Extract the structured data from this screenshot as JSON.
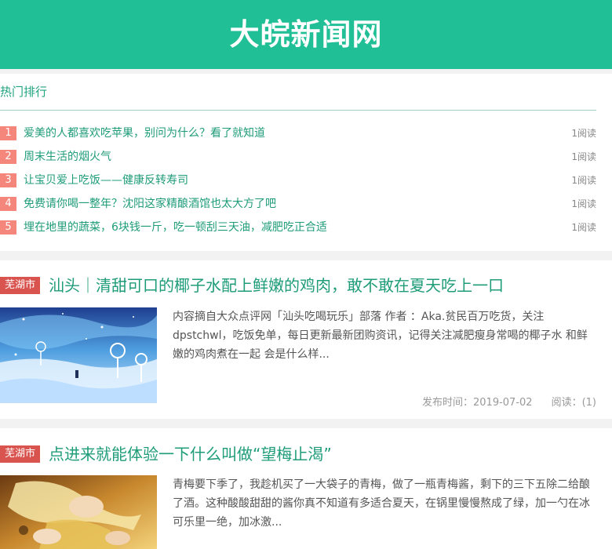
{
  "header": {
    "site_title": "大皖新闻网"
  },
  "hot": {
    "title": "热门排行",
    "items": [
      {
        "rank": "1",
        "title": "爱美的人都喜欢吃苹果，别问为什么？看了就知道",
        "reads": "1阅读"
      },
      {
        "rank": "2",
        "title": "周末生活的烟火气",
        "reads": "1阅读"
      },
      {
        "rank": "3",
        "title": "让宝贝爱上吃饭——健康反转寿司",
        "reads": "1阅读"
      },
      {
        "rank": "4",
        "title": "免费请你喝一整年？沈阳这家精酿酒馆也太大方了吧",
        "reads": "1阅读"
      },
      {
        "rank": "5",
        "title": "埋在地里的蔬菜，6块钱一斤，吃一顿刮三天油，减肥吃正合适",
        "reads": "1阅读"
      }
    ]
  },
  "articles": [
    {
      "city": "芜湖市",
      "title": "汕头｜清甜可口的椰子水配上鲜嫩的鸡肉，敢不敢在夏天吃上一口",
      "excerpt": "内容摘自大众点评网「汕头吃喝玩乐」部落 作者 ：Aka.贫民百万吃货，关注dpstchwl，吃饭免单，每日更新最新团购资讯，记得关注减肥瘦身常喝的椰子水 和鲜嫩的鸡肉煮在一起 会是什么样...",
      "publish_time": "发布时间：2019-07-02",
      "reads": "阅读：(1)"
    },
    {
      "city": "芜湖市",
      "title": "点进来就能体验一下什么叫做“望梅止渴”",
      "excerpt": "青梅要下季了，我趁机买了一大袋子的青梅，做了一瓶青梅酱，剩下的三下五除二给酿了酒。这种酸酸甜甜的酱你真不知道有多适合夏天，在锅里慢慢熬成了绿，加一勺在冰可乐里一绝，加冰激..."
    }
  ]
}
